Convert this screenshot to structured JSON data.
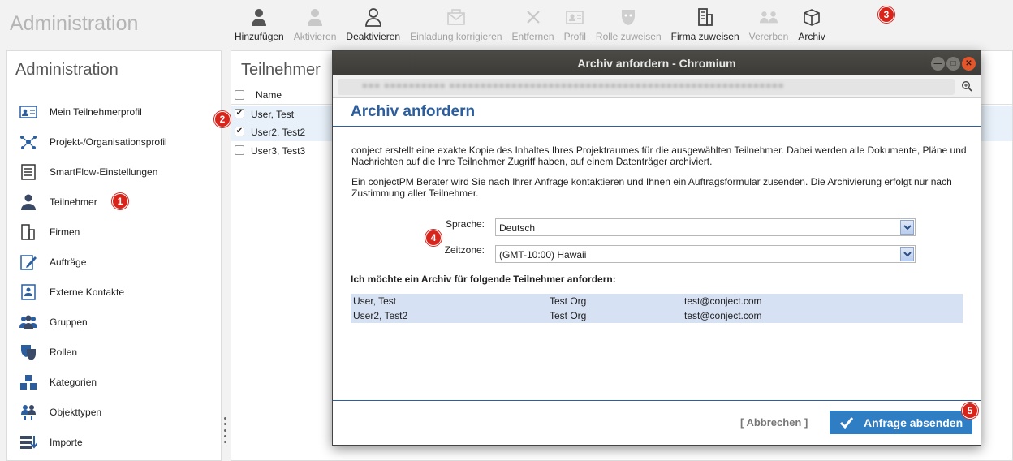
{
  "app": {
    "title": "Administration"
  },
  "toolbar": [
    {
      "label": "Hinzufügen",
      "icon": "user-add-icon",
      "enabled": true
    },
    {
      "label": "Aktivieren",
      "icon": "user-activate-icon",
      "enabled": false
    },
    {
      "label": "Deaktivieren",
      "icon": "user-deactivate-icon",
      "enabled": true
    },
    {
      "label": "Einladung korrigieren",
      "icon": "envelope-icon",
      "enabled": false
    },
    {
      "label": "Entfernen",
      "icon": "remove-icon",
      "enabled": false
    },
    {
      "label": "Profil",
      "icon": "profile-card-icon",
      "enabled": false
    },
    {
      "label": "Rolle zuweisen",
      "icon": "role-mask-icon",
      "enabled": false
    },
    {
      "label": "Firma zuweisen",
      "icon": "building-icon",
      "enabled": true
    },
    {
      "label": "Vererben",
      "icon": "inherit-users-icon",
      "enabled": false
    },
    {
      "label": "Archiv",
      "icon": "archive-box-icon",
      "enabled": true
    }
  ],
  "left": {
    "title": "Administration",
    "items": [
      {
        "label": "Mein Teilnehmerprofil",
        "icon": "profile-card-icon"
      },
      {
        "label": "Projekt-/Organisationsprofil",
        "icon": "network-icon"
      },
      {
        "label": "SmartFlow-Einstellungen",
        "icon": "list-settings-icon"
      },
      {
        "label": "Teilnehmer",
        "icon": "user-icon"
      },
      {
        "label": "Firmen",
        "icon": "building-icon"
      },
      {
        "label": "Aufträge",
        "icon": "pencil-doc-icon"
      },
      {
        "label": "Externe Kontakte",
        "icon": "contact-card-icon"
      },
      {
        "label": "Gruppen",
        "icon": "group-icon"
      },
      {
        "label": "Rollen",
        "icon": "roles-icon"
      },
      {
        "label": "Kategorien",
        "icon": "categories-icon"
      },
      {
        "label": "Objekttypen",
        "icon": "object-types-icon"
      },
      {
        "label": "Importe",
        "icon": "import-icon"
      }
    ]
  },
  "main": {
    "title": "Teilnehmer",
    "column_name": "Name",
    "rows": [
      {
        "name": "User, Test",
        "checked": true
      },
      {
        "name": "User2, Test2",
        "checked": true
      },
      {
        "name": "User3, Test3",
        "checked": false
      }
    ]
  },
  "markers": {
    "m1": "1",
    "m2": "2",
    "m3": "3",
    "m4": "4",
    "m5": "5"
  },
  "dialog": {
    "window_title": "Archiv anfordern - Chromium",
    "heading": "Archiv anfordern",
    "para1": "conject erstellt eine exakte Kopie des Inhaltes Ihres Projektraumes für die ausgewählten Teilnehmer. Dabei werden alle Dokumente, Pläne und Nachrichten auf die Ihre Teilnehmer Zugriff haben, auf einem Datenträger archiviert.",
    "para2": "Ein conjectPM Berater wird Sie nach Ihrer Anfrage kontaktieren und Ihnen ein Auftragsformular zusenden. Die Archivierung erfolgt nur nach Zustimmung aller Teilnehmer.",
    "language_label": "Sprache:",
    "language_value": "Deutsch",
    "timezone_label": "Zeitzone:",
    "timezone_value": "(GMT-10:00) Hawaii",
    "participants_heading": "Ich möchte ein Archiv für folgende Teilnehmer anfordern:",
    "participants": [
      {
        "name": "User, Test",
        "org": "Test Org",
        "email": "test@conject.com"
      },
      {
        "name": "User2, Test2",
        "org": "Test Org",
        "email": "test@conject.com"
      }
    ],
    "cancel_label": "[ Abbrechen ]",
    "submit_label": "Anfrage absenden"
  },
  "colors": {
    "accent": "#2b5e9f",
    "button": "#2f7dc3",
    "marker": "#d9241c",
    "selected_row": "#e8f1fa",
    "participant_row": "#d7e1f4"
  }
}
